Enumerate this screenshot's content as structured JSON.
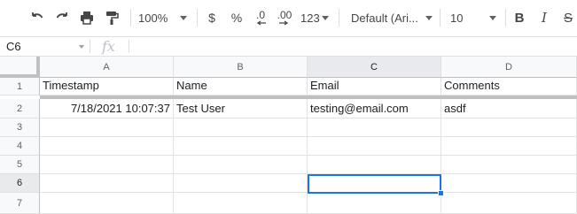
{
  "toolbar": {
    "zoom": "100%",
    "currency": "$",
    "percent": "%",
    "decimal_decrease": ".0",
    "decimal_increase": ".00",
    "number_format": "123",
    "font": "Default (Ari...",
    "font_size": "10",
    "bold": "B",
    "italic": "I",
    "strike": "S"
  },
  "formula_bar": {
    "name_box": "C6",
    "fx": "fx",
    "formula": ""
  },
  "columns": [
    "A",
    "B",
    "C",
    "D"
  ],
  "rows": [
    "1",
    "2",
    "3",
    "4",
    "5",
    "6",
    "7"
  ],
  "sheet": {
    "header": [
      "Timestamp",
      "Name",
      "Email",
      "Comments"
    ],
    "records": [
      [
        "7/18/2021 10:07:37",
        "Test User",
        "testing@email.com",
        "asdf"
      ]
    ]
  },
  "selection": {
    "cell": "C6",
    "color": "#1a73e8"
  }
}
